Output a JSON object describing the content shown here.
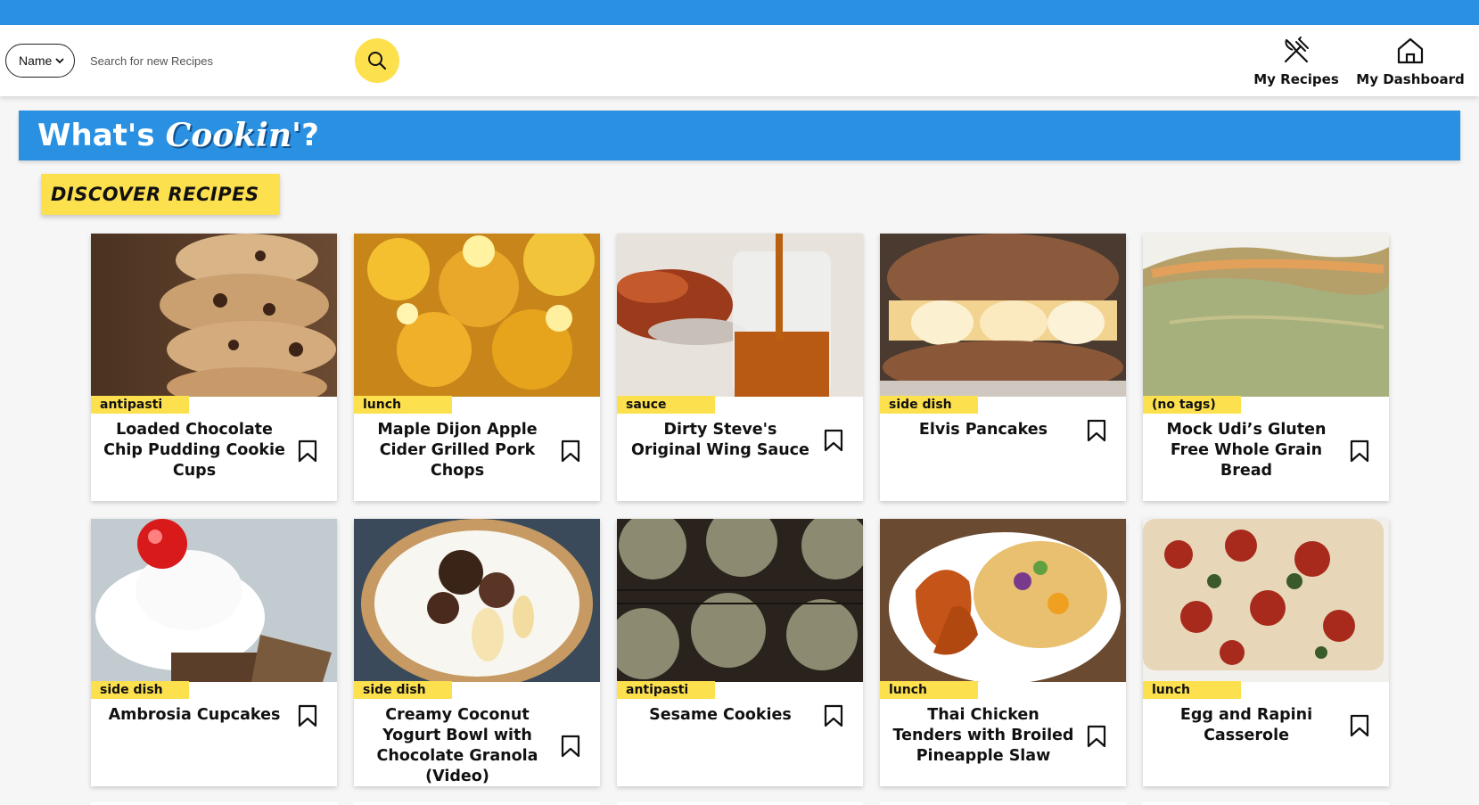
{
  "header": {
    "search_filter": "Name",
    "search_placeholder": "Search for new Recipes",
    "search_icon": "search-icon",
    "nav": [
      {
        "label": "My Recipes",
        "icon": "fork-knife-icon"
      },
      {
        "label": "My Dashboard",
        "icon": "home-icon"
      }
    ]
  },
  "hero": {
    "title_main": "What's",
    "title_script": "Cookin'",
    "title_end": "?"
  },
  "section": {
    "title": "DISCOVER RECIPES"
  },
  "recipes": [
    {
      "tag": "antipasti",
      "title": "Loaded Chocolate Chip Pudding Cookie Cups",
      "image": "chocolate-chip-cookies-image"
    },
    {
      "tag": "lunch",
      "title": "Maple Dijon Apple Cider Grilled Pork Chops",
      "image": "apple-maple-glaze-image"
    },
    {
      "tag": "sauce",
      "title": "Dirty Steve's Original Wing Sauce",
      "image": "wing-sauce-jar-image"
    },
    {
      "tag": "side dish",
      "title": "Elvis Pancakes",
      "image": "banana-pancakes-image"
    },
    {
      "tag": "(no tags)",
      "title": "Mock Udi’s Gluten Free Whole Grain Bread",
      "image": "whole-grain-bread-image"
    },
    {
      "tag": "side dish",
      "title": "Ambrosia Cupcakes",
      "image": "coconut-cupcake-image"
    },
    {
      "tag": "side dish",
      "title": "Creamy Coconut Yogurt Bowl with Chocolate Granola (Video)",
      "image": "yogurt-bowl-image"
    },
    {
      "tag": "antipasti",
      "title": "Sesame Cookies",
      "image": "sesame-cookies-image"
    },
    {
      "tag": "lunch",
      "title": "Thai Chicken Tenders with Broiled Pineapple Slaw",
      "image": "chicken-slaw-plate-image"
    },
    {
      "tag": "lunch",
      "title": "Egg and Rapini Casserole",
      "image": "casserole-image"
    }
  ],
  "colors": {
    "topbar": "#2a91e2",
    "accent_yellow": "#fde04e",
    "hero_blue": "#2a91e2"
  }
}
